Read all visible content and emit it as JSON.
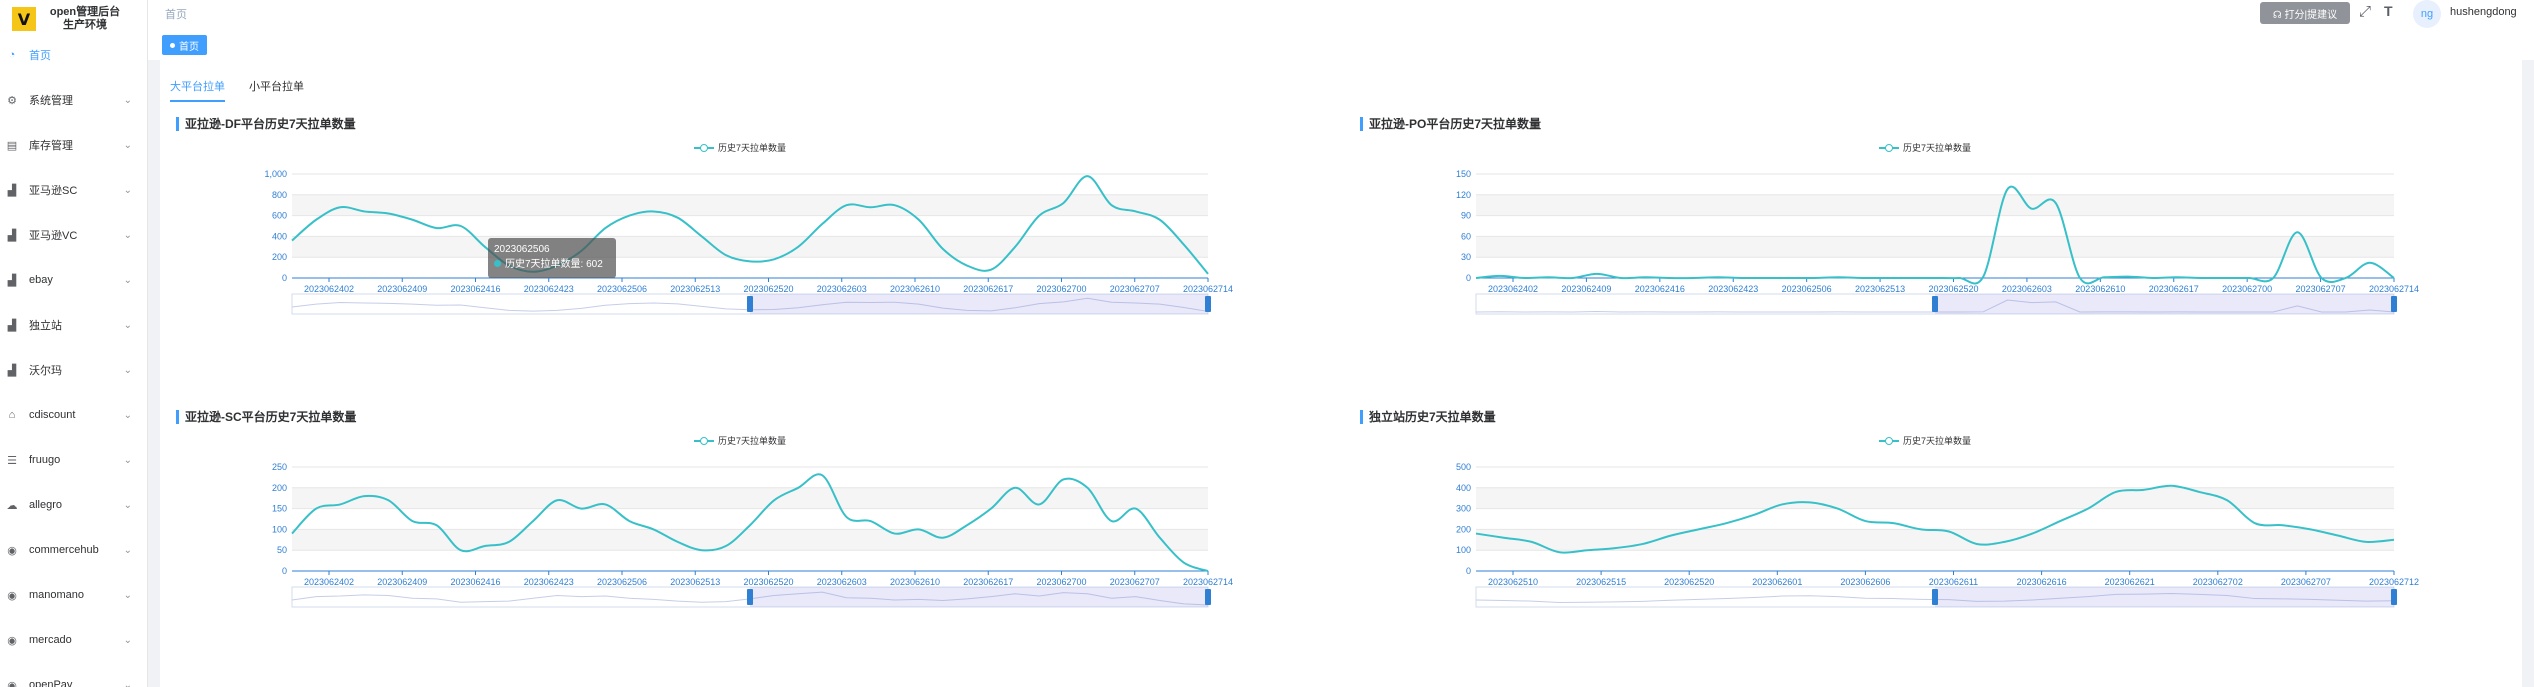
{
  "app": {
    "logo_letter": "V",
    "title_line1": "open管理后台",
    "title_line2": "生产环境"
  },
  "sidebar": {
    "items": [
      {
        "label": "首页",
        "icon": "dashboard-icon",
        "active": true
      },
      {
        "label": "系统管理",
        "icon": "gear-icon"
      },
      {
        "label": "库存管理",
        "icon": "inventory-icon"
      },
      {
        "label": "亚马逊SC",
        "icon": "bar-chart-icon"
      },
      {
        "label": "亚马逊VC",
        "icon": "bar-chart-icon"
      },
      {
        "label": "ebay",
        "icon": "bar-chart-icon"
      },
      {
        "label": "独立站",
        "icon": "bar-chart-icon"
      },
      {
        "label": "沃尔玛",
        "icon": "bar-chart-icon"
      },
      {
        "label": "cdiscount",
        "icon": "bag-icon"
      },
      {
        "label": "fruugo",
        "icon": "list-icon"
      },
      {
        "label": "allegro",
        "icon": "cloud-icon"
      },
      {
        "label": "commercehub",
        "icon": "globe-icon"
      },
      {
        "label": "manomano",
        "icon": "globe-icon"
      },
      {
        "label": "mercado",
        "icon": "globe-icon"
      },
      {
        "label": "openPay",
        "icon": "globe-icon"
      }
    ]
  },
  "header": {
    "breadcrumb": "首页",
    "tag_label": "首页",
    "feedback_label": "☊ 打分|提建议",
    "fullscreen_icon": "fullscreen-icon",
    "fontsize_icon": "font-size-icon",
    "avatar_text": "ng",
    "username": "hushengdong"
  },
  "tabs": [
    {
      "label": "大平台拉单",
      "active": true
    },
    {
      "label": "小平台拉单",
      "active": false
    }
  ],
  "tooltip": {
    "title": "2023062506",
    "series": "历史7天拉单数量",
    "value_text": "历史7天拉单数量: 602"
  },
  "colors": {
    "accent": "#409eff",
    "series": "#37c0c8"
  },
  "chart_data": [
    {
      "type": "line",
      "title": "亚拉逊-DF平台历史7天拉单数量",
      "series_name": "历史7天拉单数量",
      "x_ticks": [
        "2023062402",
        "2023062409",
        "2023062416",
        "2023062423",
        "2023062506",
        "2023062513",
        "2023062520",
        "2023062603",
        "2023062610",
        "2023062617",
        "2023062700",
        "2023062707",
        "2023062714"
      ],
      "y_ticks": [
        "0",
        "200",
        "400",
        "600",
        "800",
        "1,000"
      ],
      "ylim": [
        0,
        1000
      ],
      "values": [
        360,
        560,
        680,
        640,
        620,
        560,
        480,
        500,
        300,
        120,
        60,
        120,
        260,
        480,
        600,
        640,
        580,
        400,
        220,
        160,
        180,
        300,
        520,
        700,
        680,
        700,
        560,
        280,
        120,
        80,
        300,
        600,
        720,
        980,
        700,
        640,
        560,
        320,
        40
      ]
    },
    {
      "type": "line",
      "title": "亚拉逊-PO平台历史7天拉单数量",
      "series_name": "历史7天拉单数量",
      "x_ticks": [
        "2023062402",
        "2023062409",
        "2023062416",
        "2023062423",
        "2023062506",
        "2023062513",
        "2023062520",
        "2023062603",
        "2023062610",
        "2023062617",
        "2023062700",
        "2023062707",
        "2023062714"
      ],
      "y_ticks": [
        "0",
        "30",
        "60",
        "90",
        "120",
        "150"
      ],
      "ylim": [
        0,
        150
      ],
      "values": [
        0,
        3,
        0,
        1,
        0,
        6,
        0,
        1,
        0,
        0,
        1,
        0,
        0,
        0,
        0,
        1,
        0,
        0,
        0,
        0,
        0,
        2,
        128,
        100,
        108,
        0,
        1,
        2,
        0,
        1,
        0,
        0,
        0,
        0,
        66,
        0,
        0,
        22,
        0
      ]
    },
    {
      "type": "line",
      "title": "亚拉逊-SC平台历史7天拉单数量",
      "series_name": "历史7天拉单数量",
      "x_ticks": [
        "2023062402",
        "2023062409",
        "2023062416",
        "2023062423",
        "2023062506",
        "2023062513",
        "2023062520",
        "2023062603",
        "2023062610",
        "2023062617",
        "2023062700",
        "2023062707",
        "2023062714"
      ],
      "y_ticks": [
        "0",
        "50",
        "100",
        "150",
        "200",
        "250"
      ],
      "ylim": [
        0,
        250
      ],
      "values": [
        90,
        150,
        160,
        180,
        170,
        120,
        110,
        50,
        60,
        70,
        120,
        170,
        150,
        160,
        120,
        100,
        70,
        50,
        60,
        110,
        170,
        200,
        230,
        130,
        120,
        90,
        100,
        80,
        110,
        150,
        200,
        160,
        220,
        200,
        120,
        150,
        80,
        20,
        0
      ]
    },
    {
      "type": "line",
      "title": "独立站历史7天拉单数量",
      "series_name": "历史7天拉单数量",
      "x_ticks": [
        "2023062510",
        "2023062515",
        "2023062520",
        "2023062601",
        "2023062606",
        "2023062611",
        "2023062616",
        "2023062621",
        "2023062702",
        "2023062707",
        "2023062712"
      ],
      "y_ticks": [
        "0",
        "100",
        "200",
        "300",
        "400",
        "500"
      ],
      "ylim": [
        0,
        500
      ],
      "values": [
        180,
        160,
        140,
        90,
        100,
        110,
        130,
        170,
        200,
        230,
        270,
        320,
        330,
        300,
        240,
        230,
        200,
        190,
        130,
        140,
        180,
        240,
        300,
        380,
        390,
        410,
        380,
        340,
        230,
        220,
        200,
        170,
        140,
        150
      ]
    }
  ]
}
